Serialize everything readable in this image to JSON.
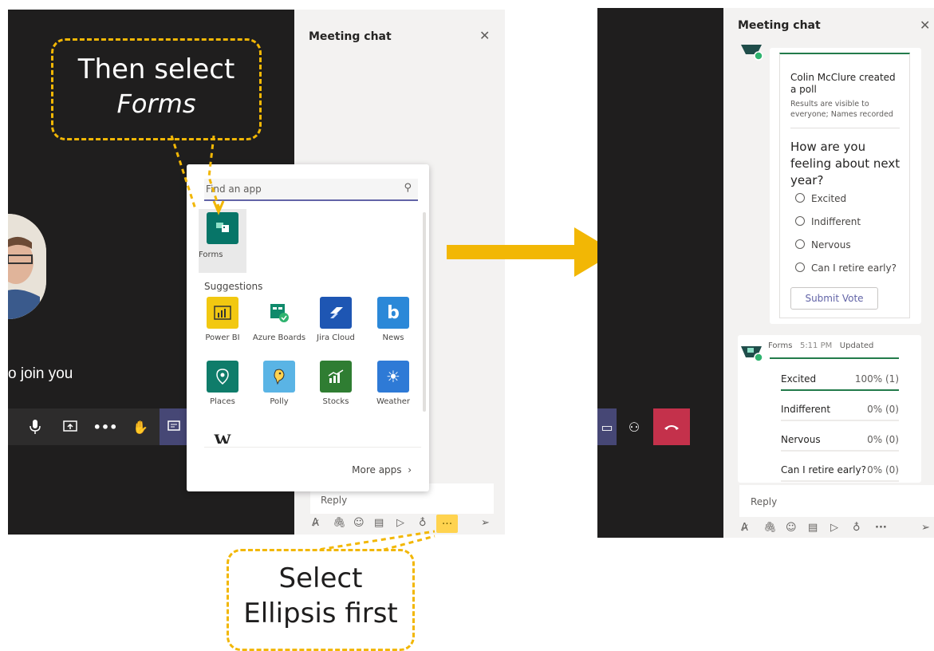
{
  "left_callout": {
    "line1": "Then select",
    "line2": "Forms"
  },
  "bottom_callout": {
    "line1": "Select",
    "line2": "Ellipsis first"
  },
  "left_panel": {
    "chat_title": "Meeting chat",
    "join_text": "o join you",
    "search_placeholder": "Find an app",
    "pinned_app": "Forms",
    "suggestions_label": "Suggestions",
    "apps": [
      {
        "label": "Power BI",
        "color": "#f2c811",
        "icon": "power-bi-icon"
      },
      {
        "label": "Azure Boards",
        "color": "#ffffff",
        "icon": "azure-boards-icon"
      },
      {
        "label": "Jira Cloud",
        "color": "#1e56b3",
        "icon": "jira-icon"
      },
      {
        "label": "News",
        "color": "#2b88d8",
        "icon": "bing-icon"
      },
      {
        "label": "Places",
        "color": "#0f7c6a",
        "icon": "map-pin-icon"
      },
      {
        "label": "Polly",
        "color": "#5ab4e5",
        "icon": "polly-icon"
      },
      {
        "label": "Stocks",
        "color": "#2f7d32",
        "icon": "stocks-icon"
      },
      {
        "label": "Weather",
        "color": "#2e7ad6",
        "icon": "sun-icon"
      }
    ],
    "more_apps": "More apps",
    "reply_placeholder": "Reply"
  },
  "right_panel": {
    "chat_title": "Meeting chat",
    "poll": {
      "creator": "Colin McClure created a poll",
      "visibility": "Results are visible to everyone; Names recorded",
      "question": "How are you feeling about next year?",
      "options": [
        "Excited",
        "Indifferent",
        "Nervous",
        "Can I retire early?"
      ],
      "submit_label": "Submit Vote"
    },
    "results": {
      "app": "Forms",
      "time": "5:11 PM",
      "status": "Updated",
      "rows": [
        {
          "name": "Excited",
          "value": "100% (1)",
          "fraction": 1.0
        },
        {
          "name": "Indifferent",
          "value": "0% (0)",
          "fraction": 0
        },
        {
          "name": "Nervous",
          "value": "0% (0)",
          "fraction": 0
        },
        {
          "name": "Can I retire early?",
          "value": "0% (0)",
          "fraction": 0
        }
      ]
    },
    "reply_placeholder": "Reply"
  },
  "colors": {
    "accent": "#f2b705",
    "teams_purple": "#6264a7",
    "forms_green": "#237b4b",
    "hangup": "#c4314b"
  }
}
